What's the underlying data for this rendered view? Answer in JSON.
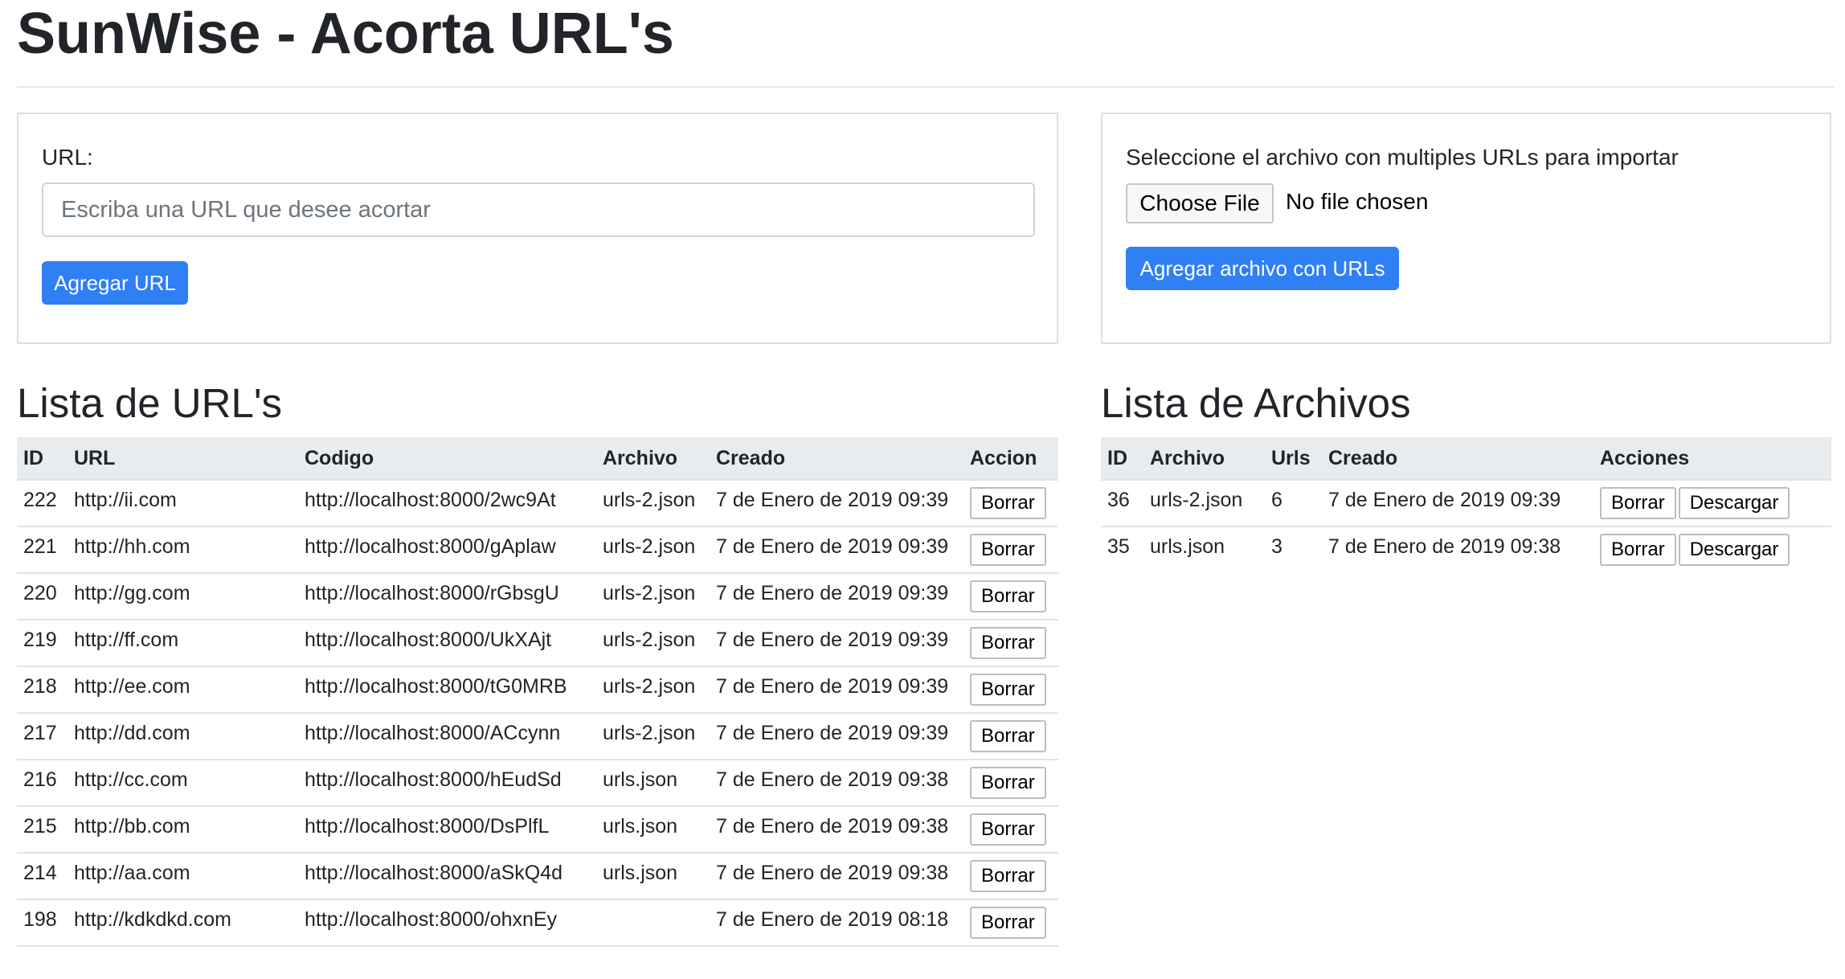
{
  "app": {
    "title": "SunWise - Acorta URL's"
  },
  "url_form": {
    "label": "URL:",
    "placeholder": "Escriba una URL que desee acortar",
    "value": "",
    "submit_label": "Agregar URL"
  },
  "file_form": {
    "label": "Seleccione el archivo con multiples URLs para importar",
    "choose_label": "Choose File",
    "status": "No file chosen",
    "submit_label": "Agregar archivo con URLs"
  },
  "urls_section": {
    "title": "Lista de URL's",
    "columns": [
      "ID",
      "URL",
      "Codigo",
      "Archivo",
      "Creado",
      "Accion"
    ],
    "delete_label": "Borrar",
    "rows": [
      {
        "id": "222",
        "url": "http://ii.com",
        "codigo": "http://localhost:8000/2wc9At",
        "archivo": "urls-2.json",
        "creado": "7 de Enero de 2019 09:39"
      },
      {
        "id": "221",
        "url": "http://hh.com",
        "codigo": "http://localhost:8000/gAplaw",
        "archivo": "urls-2.json",
        "creado": "7 de Enero de 2019 09:39"
      },
      {
        "id": "220",
        "url": "http://gg.com",
        "codigo": "http://localhost:8000/rGbsgU",
        "archivo": "urls-2.json",
        "creado": "7 de Enero de 2019 09:39"
      },
      {
        "id": "219",
        "url": "http://ff.com",
        "codigo": "http://localhost:8000/UkXAjt",
        "archivo": "urls-2.json",
        "creado": "7 de Enero de 2019 09:39"
      },
      {
        "id": "218",
        "url": "http://ee.com",
        "codigo": "http://localhost:8000/tG0MRB",
        "archivo": "urls-2.json",
        "creado": "7 de Enero de 2019 09:39"
      },
      {
        "id": "217",
        "url": "http://dd.com",
        "codigo": "http://localhost:8000/ACcynn",
        "archivo": "urls-2.json",
        "creado": "7 de Enero de 2019 09:39"
      },
      {
        "id": "216",
        "url": "http://cc.com",
        "codigo": "http://localhost:8000/hEudSd",
        "archivo": "urls.json",
        "creado": "7 de Enero de 2019 09:38"
      },
      {
        "id": "215",
        "url": "http://bb.com",
        "codigo": "http://localhost:8000/DsPlfL",
        "archivo": "urls.json",
        "creado": "7 de Enero de 2019 09:38"
      },
      {
        "id": "214",
        "url": "http://aa.com",
        "codigo": "http://localhost:8000/aSkQ4d",
        "archivo": "urls.json",
        "creado": "7 de Enero de 2019 09:38"
      },
      {
        "id": "198",
        "url": "http://kdkdkd.com",
        "codigo": "http://localhost:8000/ohxnEy",
        "archivo": "",
        "creado": "7 de Enero de 2019 08:18"
      }
    ]
  },
  "files_section": {
    "title": "Lista de Archivos",
    "columns": [
      "ID",
      "Archivo",
      "Urls",
      "Creado",
      "Acciones"
    ],
    "delete_label": "Borrar",
    "download_label": "Descargar",
    "rows": [
      {
        "id": "36",
        "archivo": "urls-2.json",
        "urls": "6",
        "creado": "7 de Enero de 2019 09:39"
      },
      {
        "id": "35",
        "archivo": "urls.json",
        "urls": "3",
        "creado": "7 de Enero de 2019 09:38"
      }
    ]
  },
  "colors": {
    "primary": "#2f7ff5",
    "table_header_bg": "#e9ecef",
    "card_border": "#dfdfdf"
  }
}
